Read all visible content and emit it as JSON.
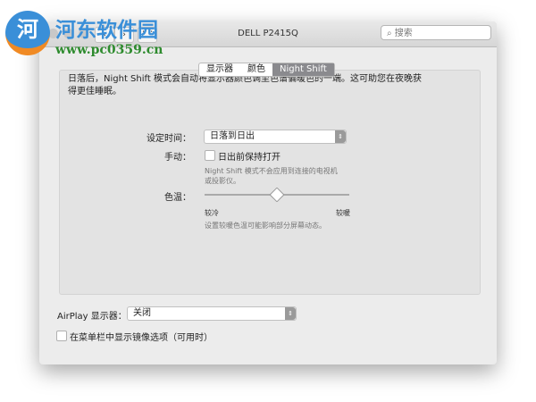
{
  "window": {
    "title": "DELL P2415Q",
    "search_placeholder": "搜索"
  },
  "tabs": [
    {
      "label": "显示器"
    },
    {
      "label": "颜色"
    },
    {
      "label": "Night Shift",
      "active": true
    }
  ],
  "night_shift": {
    "description": "日落后，Night Shift 模式会自动将显示器颜色调至色谱偏暖色的一端。这可助您在夜晚获得更佳睡眠。",
    "schedule_label": "设定时间：",
    "schedule_value": "日落到日出",
    "manual_label": "手动：",
    "manual_checkbox": "日出前保持打开",
    "manual_checked": false,
    "tv_note_1": "Night Shift 模式不会应用到连接的电视机",
    "tv_note_2": "或投影仪。",
    "temp_label": "色温：",
    "temp_less": "较冷",
    "temp_more": "较暖",
    "temp_value": 0.5,
    "temp_note": "设置较暖色温可能影响部分屏幕动态。"
  },
  "airplay": {
    "label": "AirPlay 显示器：",
    "value": "关闭"
  },
  "mirror_option": {
    "label": "在菜单栏中显示镜像选项（可用时）",
    "checked": false
  },
  "watermark": {
    "name": "河东软件园",
    "url": "www.pc0359.cn"
  }
}
